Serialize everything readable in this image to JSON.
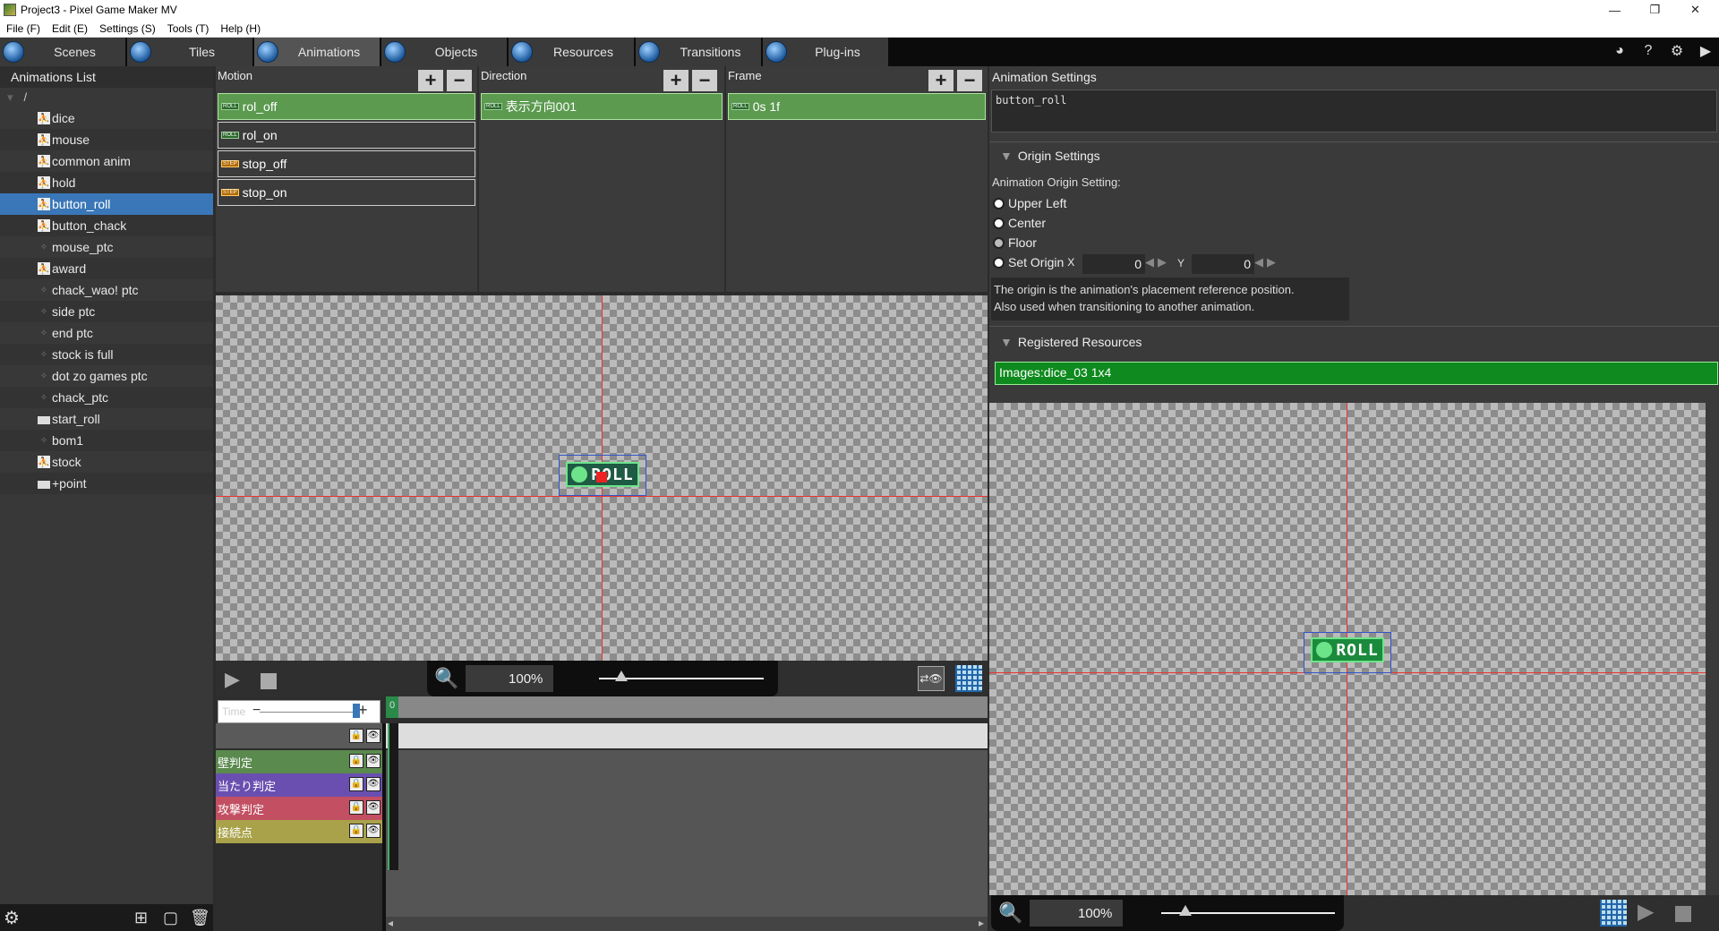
{
  "window": {
    "title": "Project3 - Pixel Game Maker MV",
    "minimize": "—",
    "restore": "❐",
    "close": "✕"
  },
  "menu": [
    "File (F)",
    "Edit (E)",
    "Settings (S)",
    "Tools (T)",
    "Help (H)"
  ],
  "tabs": [
    {
      "label": "Scenes",
      "active": false
    },
    {
      "label": "Tiles",
      "active": false
    },
    {
      "label": "Animations",
      "active": true
    },
    {
      "label": "Objects",
      "active": false
    },
    {
      "label": "Resources",
      "active": false
    },
    {
      "label": "Transitions",
      "active": false
    },
    {
      "label": "Plug-ins",
      "active": false
    }
  ],
  "animations_list": {
    "header": "Animations List",
    "root": "/",
    "items": [
      {
        "label": "dice",
        "icon": "anim"
      },
      {
        "label": "mouse",
        "icon": "anim"
      },
      {
        "label": "common anim",
        "icon": "anim"
      },
      {
        "label": "hold",
        "icon": "anim"
      },
      {
        "label": "button_roll",
        "icon": "anim",
        "selected": true
      },
      {
        "label": "button_chack",
        "icon": "anim"
      },
      {
        "label": "mouse_ptc",
        "icon": "ptc"
      },
      {
        "label": "award",
        "icon": "anim"
      },
      {
        "label": "chack_wao! ptc",
        "icon": "ptc"
      },
      {
        "label": "side ptc",
        "icon": "ptc"
      },
      {
        "label": "end ptc",
        "icon": "ptc"
      },
      {
        "label": "stock is full",
        "icon": "ptc"
      },
      {
        "label": "dot zo games ptc",
        "icon": "ptc"
      },
      {
        "label": "chack_ptc",
        "icon": "ptc"
      },
      {
        "label": "start_roll",
        "icon": "folder"
      },
      {
        "label": "bom1",
        "icon": "ptc"
      },
      {
        "label": "stock",
        "icon": "anim"
      },
      {
        "label": "+point",
        "icon": "folder"
      }
    ]
  },
  "motion": {
    "header": "Motion",
    "items": [
      {
        "label": "rol_off",
        "badge": "ROLL",
        "selected": true
      },
      {
        "label": "rol_on",
        "badge": "ROLL"
      },
      {
        "label": "stop_off",
        "badge": "STEP"
      },
      {
        "label": "stop_on",
        "badge": "STEP"
      }
    ]
  },
  "direction": {
    "header": "Direction",
    "items": [
      {
        "label": "表示方向001",
        "badge": "ROLL"
      }
    ]
  },
  "frame": {
    "header": "Frame",
    "items": [
      {
        "label": "0s 1f",
        "badge": "ROLL"
      }
    ]
  },
  "sprite_text": "ROLL",
  "zoom_main": "100%",
  "zoom_preview": "100%",
  "timeline": {
    "time_placeholder": "Time",
    "marker": "0",
    "tracks": [
      {
        "label": "壁判定",
        "color": "#5b8a4e"
      },
      {
        "label": "当たり判定",
        "color": "#6a4fb0"
      },
      {
        "label": "攻撃判定",
        "color": "#c24f62"
      },
      {
        "label": "接続点",
        "color": "#a9a24a"
      }
    ]
  },
  "settings": {
    "header": "Animation Settings",
    "name": "button_roll",
    "origin_section": "Origin Settings",
    "origin_label": "Animation Origin Setting:",
    "options": [
      "Upper Left",
      "Center",
      "Floor",
      "Set Origin"
    ],
    "x_label": "X",
    "y_label": "Y",
    "x_value": "0",
    "y_value": "0",
    "description_line1": "The origin is the animation's placement reference position.",
    "description_line2": "Also used when transitioning to another animation.",
    "resources_section": "Registered Resources",
    "resource": "Images:dice_03 1x4"
  }
}
